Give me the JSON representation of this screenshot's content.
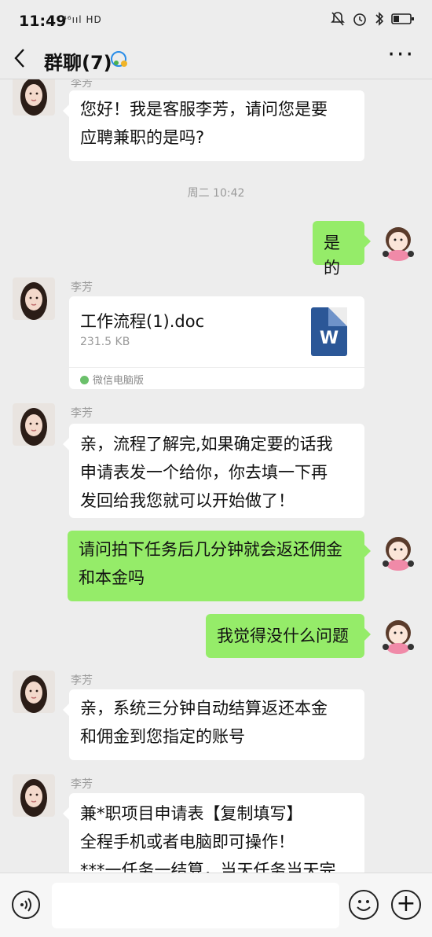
{
  "status": {
    "time": "11:49",
    "signal": "⁴⁶ııl HD"
  },
  "header": {
    "title": "群聊(7)"
  },
  "messages": {
    "m1": {
      "sender": "李芳",
      "line1": "您好！我是客服李芳，请问您是要",
      "line2": "应聘兼职的是吗?"
    },
    "ts": "周二 10:42",
    "m2": {
      "text": "是的"
    },
    "m3": {
      "sender": "李芳",
      "file_name": "工作流程(1).doc",
      "file_size": "231.5 KB",
      "file_source": "微信电脑版",
      "file_badge": "W"
    },
    "m4": {
      "sender": "李芳",
      "line1": "亲，流程了解完,如果确定要的话我",
      "line2": "申请表发一个给你，你去填一下再",
      "line3": "发回给我您就可以开始做了！"
    },
    "m5": {
      "line1": "请问拍下任务后几分钟就会返还佣金",
      "line2": "和本金吗"
    },
    "m6": {
      "text": "我觉得没什么问题"
    },
    "m7": {
      "sender": "李芳",
      "line1": "亲，系统三分钟自动结算返还本金",
      "line2": "和佣金到您指定的账号"
    },
    "m8": {
      "sender": "李芳",
      "line1": "兼*职项目申请表【复制填写】",
      "line2": "全程手机或者电脑即可操作！",
      "line3": "***一任务一结算，当天任务当天完"
    }
  },
  "composer": {
    "plus_label": "+"
  },
  "colors": {
    "background": "#ededed",
    "my_bubble": "#95ec69",
    "their_bubble": "#ffffff"
  },
  "icons": [
    "back-arrow-icon",
    "group-chat-icon",
    "more-icon",
    "voice-icon",
    "emoji-icon",
    "plus-icon",
    "word-file-icon"
  ]
}
